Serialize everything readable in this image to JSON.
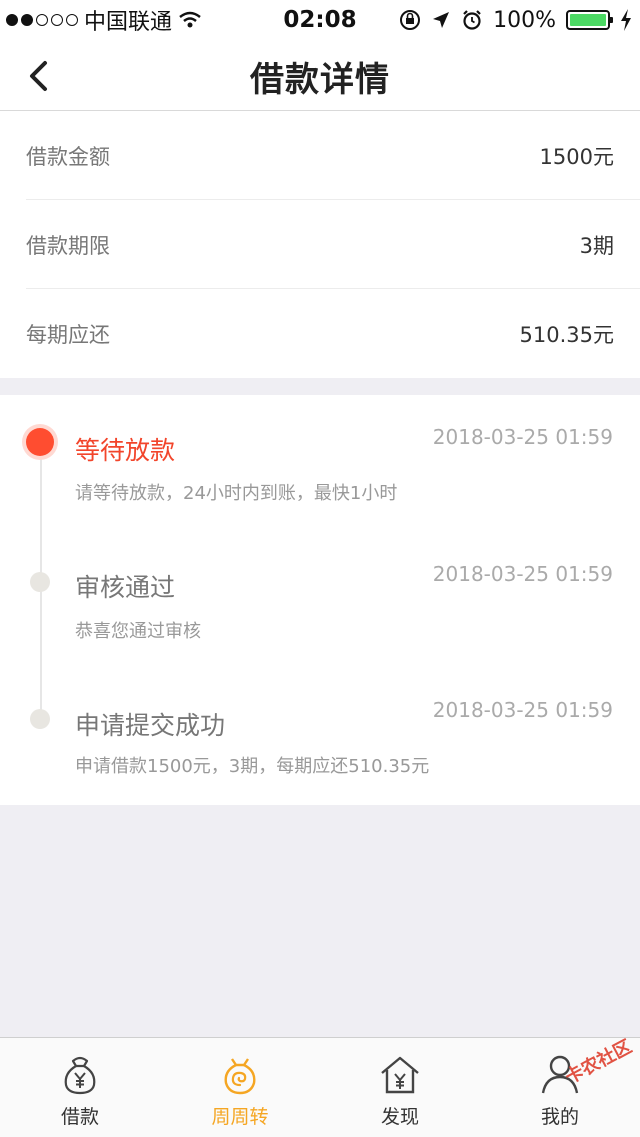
{
  "status_bar": {
    "carrier": "中国联通",
    "time": "02:08",
    "battery": "100%"
  },
  "nav": {
    "title": "借款详情"
  },
  "loan_info": [
    {
      "label": "借款金额",
      "value": "1500元"
    },
    {
      "label": "借款期限",
      "value": "3期"
    },
    {
      "label": "每期应还",
      "value": "510.35元"
    }
  ],
  "timeline": [
    {
      "title": "等待放款",
      "time": "2018-03-25 01:59",
      "desc": "请等待放款，24小时内到账，最快1小时",
      "active": true
    },
    {
      "title": "审核通过",
      "time": "2018-03-25 01:59",
      "desc": "恭喜您通过审核",
      "active": false
    },
    {
      "title": "申请提交成功",
      "time": "2018-03-25 01:59",
      "desc": "申请借款1500元，3期，每期应还510.35元",
      "active": false
    }
  ],
  "tabs": [
    {
      "label": "借款",
      "icon": "money-bag-icon"
    },
    {
      "label": "周周转",
      "icon": "spiral-bag-icon"
    },
    {
      "label": "发现",
      "icon": "house-yen-icon"
    },
    {
      "label": "我的",
      "icon": "user-icon"
    }
  ],
  "watermark": "卡农社区",
  "colors": {
    "accent": "#f2452b",
    "tab_active": "#f5a623",
    "battery": "#4cd964"
  }
}
